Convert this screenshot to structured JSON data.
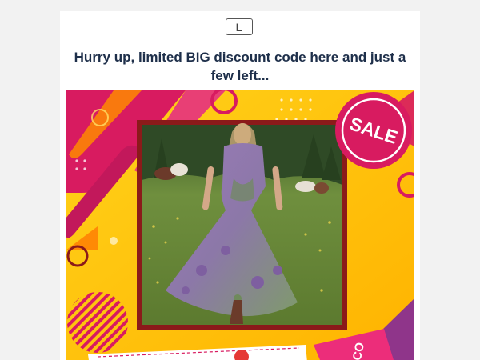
{
  "email": {
    "logo_letter": "L",
    "headline": "Hurry up, limited BIG discount code here and just a few left..."
  },
  "banner": {
    "sale_badge": "SALE",
    "coupon_tag_text": "CO",
    "colors": {
      "yellow": "#ffcc00",
      "magenta": "#d81b60",
      "frame": "#8b1a1a",
      "coupon_pink": "#ec2d7a"
    }
  }
}
